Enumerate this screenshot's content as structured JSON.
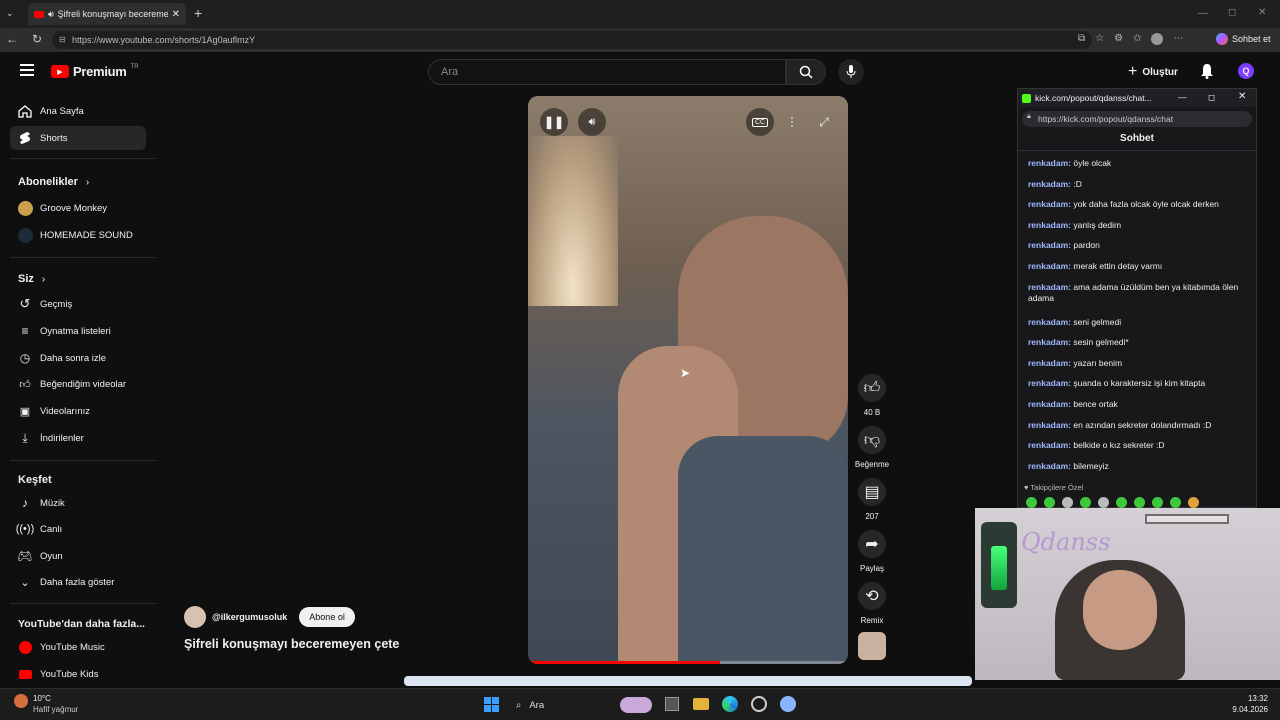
{
  "browser": {
    "tab_title": "Şifreli konuşmayı beceremeyen",
    "url": "https://www.youtube.com/shorts/1Ag0auflmzY",
    "right_button": "Sohbet et"
  },
  "header": {
    "logo": "Premium",
    "logo_badge": "TR",
    "search_placeholder": "Ara",
    "create_label": "Oluştur"
  },
  "sidebar": {
    "main": [
      {
        "label": "Ana Sayfa",
        "icon": "home-icon"
      },
      {
        "label": "Shorts",
        "icon": "shorts-icon"
      }
    ],
    "subs_title": "Abonelikler",
    "subs": [
      {
        "label": "Groove Monkey"
      },
      {
        "label": "HOMEMADE SOUND"
      }
    ],
    "you_title": "Siz",
    "you": [
      {
        "label": "Geçmiş"
      },
      {
        "label": "Oynatma listeleri"
      },
      {
        "label": "Daha sonra izle"
      },
      {
        "label": "Beğendiğim videolar"
      },
      {
        "label": "Videolarınız"
      },
      {
        "label": "İndirilenler"
      }
    ],
    "explore_title": "Keşfet",
    "explore": [
      {
        "label": "Müzik"
      },
      {
        "label": "Canlı"
      },
      {
        "label": "Oyun"
      },
      {
        "label": "Daha fazla göster"
      }
    ],
    "more_title": "YouTube'dan daha fazla...",
    "more": [
      {
        "label": "YouTube Music"
      },
      {
        "label": "YouTube Kids"
      }
    ]
  },
  "short": {
    "channel": "@ilkergumusoluk",
    "subscribe": "Abone ol",
    "title": "Şifreli konuşmayı beceremeyen çete",
    "progress": 0.6,
    "actions": {
      "like_count": "40 B",
      "dislike": "Beğenme",
      "comments": "207",
      "share": "Paylaş",
      "remix": "Remix"
    }
  },
  "chat": {
    "url_short": "kick.com/popout/qdanss/chat...",
    "url": "https://kick.com/popout/qdanss/chat",
    "title": "Sohbet",
    "messages": [
      {
        "user": "renkadam:",
        "text": "öyle olcak"
      },
      {
        "user": "renkadam:",
        "text": ":D"
      },
      {
        "user": "renkadam:",
        "text": "yok daha fazla olcak öyle olcak derken"
      },
      {
        "user": "renkadam:",
        "text": "yanlış dedim"
      },
      {
        "user": "renkadam:",
        "text": "pardon"
      },
      {
        "user": "renkadam:",
        "text": "merak ettin detay varmı"
      },
      {
        "user": "renkadam:",
        "text": "ama adama üzüldüm ben ya kitabımda ölen adama"
      },
      {
        "user": "renkadam:",
        "text": "seni gelmedi"
      },
      {
        "user": "renkadam:",
        "text": "sesin gelmedi*"
      },
      {
        "user": "renkadam:",
        "text": "yazarı benim"
      },
      {
        "user": "renkadam:",
        "text": "şuanda o karaktersiz işi kim kitapta"
      },
      {
        "user": "renkadam:",
        "text": "bence ortak"
      },
      {
        "user": "renkadam:",
        "text": "en azından sekreter dolandırmadı :D"
      },
      {
        "user": "renkadam:",
        "text": "belkide o kız sekreter :D"
      },
      {
        "user": "renkadam:",
        "text": "bilemeyiz"
      }
    ],
    "followers_only": "Takipçilere Özel"
  },
  "cam": {
    "overlay_text": "Qdanss"
  },
  "taskbar": {
    "weather_temp": "10°C",
    "weather_desc": "Hafif yağmur",
    "search": "Ara",
    "time": "13:32",
    "date": "9.04.2026"
  }
}
